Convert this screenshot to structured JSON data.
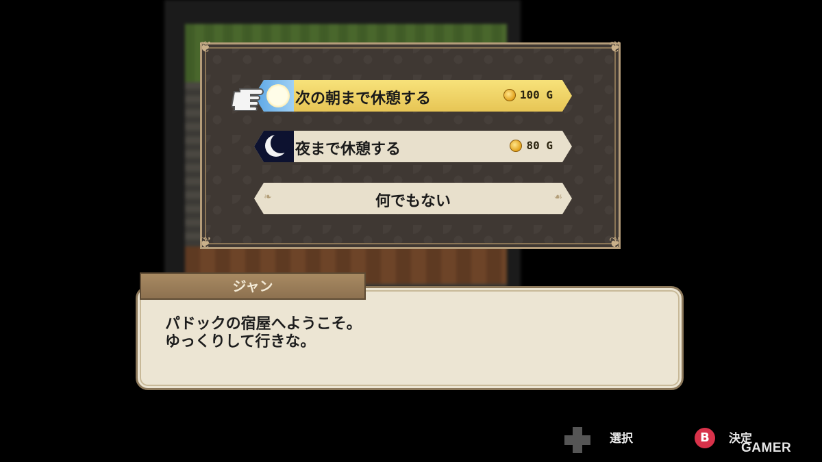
{
  "menu": {
    "options": [
      {
        "label": "次の朝まで休憩する",
        "price": "100 G",
        "icon": "sun-icon",
        "selected": true
      },
      {
        "label": "夜まで休憩する",
        "price": "80 G",
        "icon": "moon-icon",
        "selected": false
      },
      {
        "label": "何でもない",
        "selected": false
      }
    ]
  },
  "dialog": {
    "speaker": "ジャン",
    "text": "パドックの宿屋へようこそ。\nゆっくりして行きな。"
  },
  "controls": {
    "dpad_label": "選択",
    "b_button_glyph": "B",
    "b_label": "決定"
  },
  "watermark": "GAMER",
  "colors": {
    "selected_option": "#f0d66a",
    "option_bg": "#e8e0cc",
    "window_bg": "#3f3833",
    "nameplate": "#9a7d58",
    "b_button": "#d8324a"
  }
}
